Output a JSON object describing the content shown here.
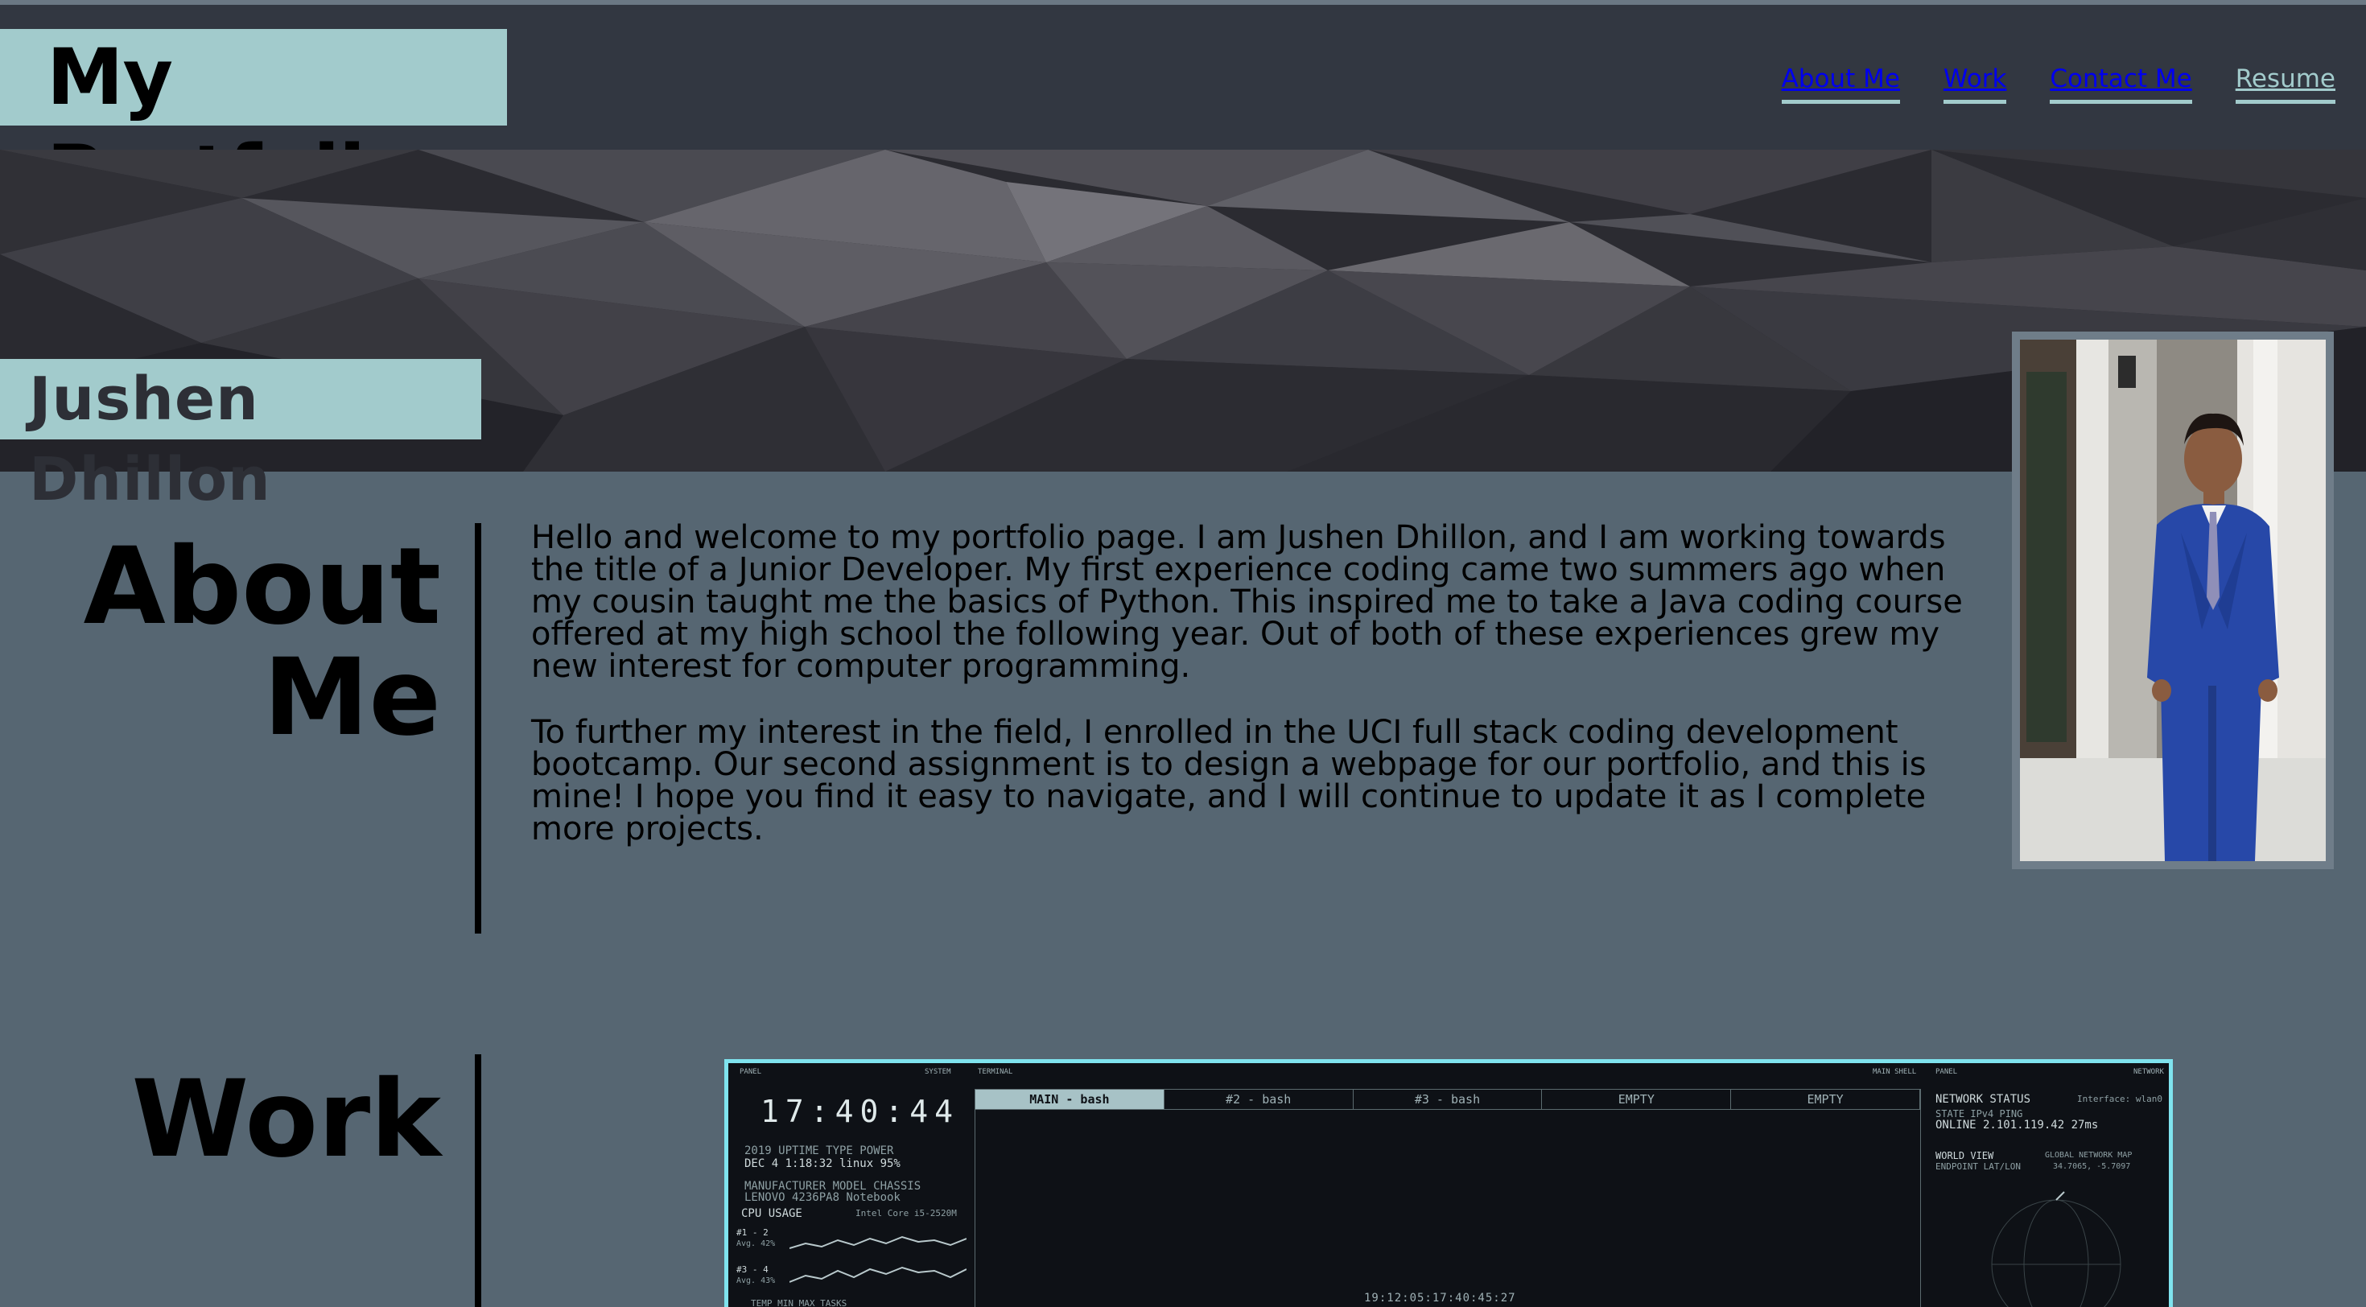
{
  "header": {
    "title": "My Portfolio",
    "nav": [
      {
        "label": "About Me",
        "style": "blue"
      },
      {
        "label": "Work",
        "style": "blue"
      },
      {
        "label": "Contact Me",
        "style": "blue"
      },
      {
        "label": "Resume",
        "style": "light"
      }
    ]
  },
  "hero": {
    "name": "Jushen Dhillon"
  },
  "about": {
    "title_line1": "About",
    "title_line2": "Me",
    "paragraphs": [
      "Hello and welcome to my portfolio page. I am Jushen Dhillon, and I am working towards the title of a Junior Developer. My first experience coding came two summers ago when my cousin taught me the basics of Python. This inspired me to take a Java coding course offered at my high school the following year. Out of both of these experiences grew my new interest for computer programming.",
      "To further my interest in the field, I enrolled in the UCI full stack coding development bootcamp. Our second assignment is to design a webpage for our portfolio, and this is mine! I hope you find it easy to navigate, and I will continue to update it as I complete more projects."
    ]
  },
  "work": {
    "title": "Work",
    "screenshot": {
      "panel_label": "PANEL",
      "system_label": "SYSTEM",
      "terminal_label": "TERMINAL",
      "main_shell_label": "MAIN SHELL",
      "panel_label_right": "PANEL",
      "network_label": "NETWORK",
      "clock": "17:40:44",
      "stats_labels": "2019   UPTIME   TYPE   POWER",
      "stats_values": "DEC 4  1:18:32  linux  95%",
      "hw_labels": "MANUFACTURER  MODEL    CHASSIS",
      "hw_values": "LENOVO        4236PA8  Notebook",
      "cpu_label": "CPU USAGE",
      "cpu_model": "Intel Core i5-2520M",
      "cpu_row1": "#1 - 2",
      "cpu_row1_avg": "Avg. 42%",
      "cpu_row2": "#3 - 4",
      "cpu_row2_avg": "Avg. 43%",
      "bottom_labels": "TEMP    MIN    MAX    TASKS",
      "tabs": [
        "MAIN - bash",
        "#2 - bash",
        "#3 - bash",
        "EMPTY",
        "EMPTY"
      ],
      "network_status": "NETWORK STATUS",
      "interface": "Interface: wlan0",
      "state_labels": "STATE    IPv4          PING",
      "state_values": "ONLINE   2.101.119.42  27ms",
      "world_view": "WORLD VIEW",
      "global_map": "GLOBAL NETWORK MAP",
      "endpoint": "ENDPOINT LAT/LON",
      "endpoint_vals": "34.7065, -5.7097",
      "footer": "19:12:05:17:40:45:27"
    }
  },
  "colors": {
    "page_bg": "#566672",
    "header_bg": "#323741",
    "accent": "#a2cbcc",
    "screenshot_border": "#7fe3ee"
  }
}
